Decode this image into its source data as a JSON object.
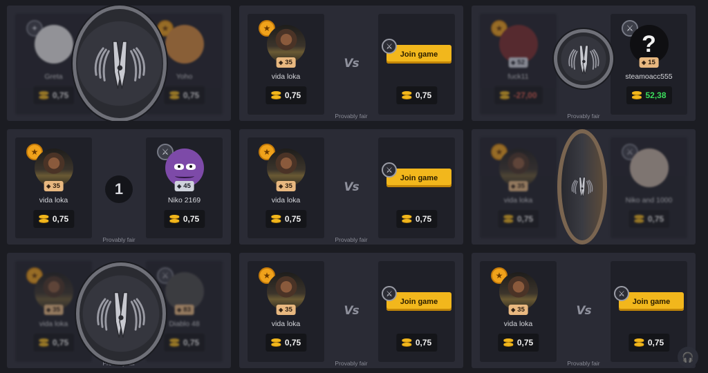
{
  "provably_fair_label": "Provably fair",
  "vs_label": "Vs",
  "join_label": "Join game",
  "support_icon": "headset-icon",
  "cards": [
    {
      "id": "c1",
      "state": "flipping",
      "left": {
        "name": "Greta",
        "level": "",
        "bet": "0,75"
      },
      "right": {
        "name": "Yoho",
        "level": "",
        "bet": "0,75"
      }
    },
    {
      "id": "c2",
      "state": "open",
      "left": {
        "name": "vida loka",
        "level": "35",
        "bet": "0,75"
      },
      "right": {
        "bet": "0,75"
      }
    },
    {
      "id": "c3",
      "state": "done",
      "left": {
        "name": "fuck11",
        "level": "52",
        "result": "-27,00"
      },
      "right": {
        "name": "steamoacc555",
        "level": "15",
        "result": "52,38"
      }
    },
    {
      "id": "c4",
      "state": "countdown",
      "countdown": "1",
      "left": {
        "name": "vida loka",
        "level": "35",
        "bet": "0,75"
      },
      "right": {
        "name": "Niko 2169",
        "level": "45",
        "bet": "0,75"
      }
    },
    {
      "id": "c5",
      "state": "open",
      "left": {
        "name": "vida loka",
        "level": "35",
        "bet": "0,75"
      },
      "right": {
        "bet": "0,75"
      }
    },
    {
      "id": "c6",
      "state": "flipping",
      "left": {
        "name": "vida loka",
        "level": "35",
        "bet": "0,75"
      },
      "right": {
        "name": "Niko and 1000",
        "level": "",
        "bet": "0,75"
      }
    },
    {
      "id": "c7",
      "state": "flipping",
      "left": {
        "name": "vida loka",
        "level": "35",
        "bet": "0,75"
      },
      "right": {
        "name": "Diablo 48",
        "level": "83",
        "bet": "0,75"
      }
    },
    {
      "id": "c8",
      "state": "open",
      "left": {
        "name": "vida loka",
        "level": "35",
        "bet": "0,75"
      },
      "right": {
        "bet": "0,75"
      }
    },
    {
      "id": "c9",
      "state": "open",
      "left": {
        "name": "vida loka",
        "level": "35",
        "bet": "0,75"
      },
      "right": {
        "bet": "0,75"
      }
    }
  ]
}
